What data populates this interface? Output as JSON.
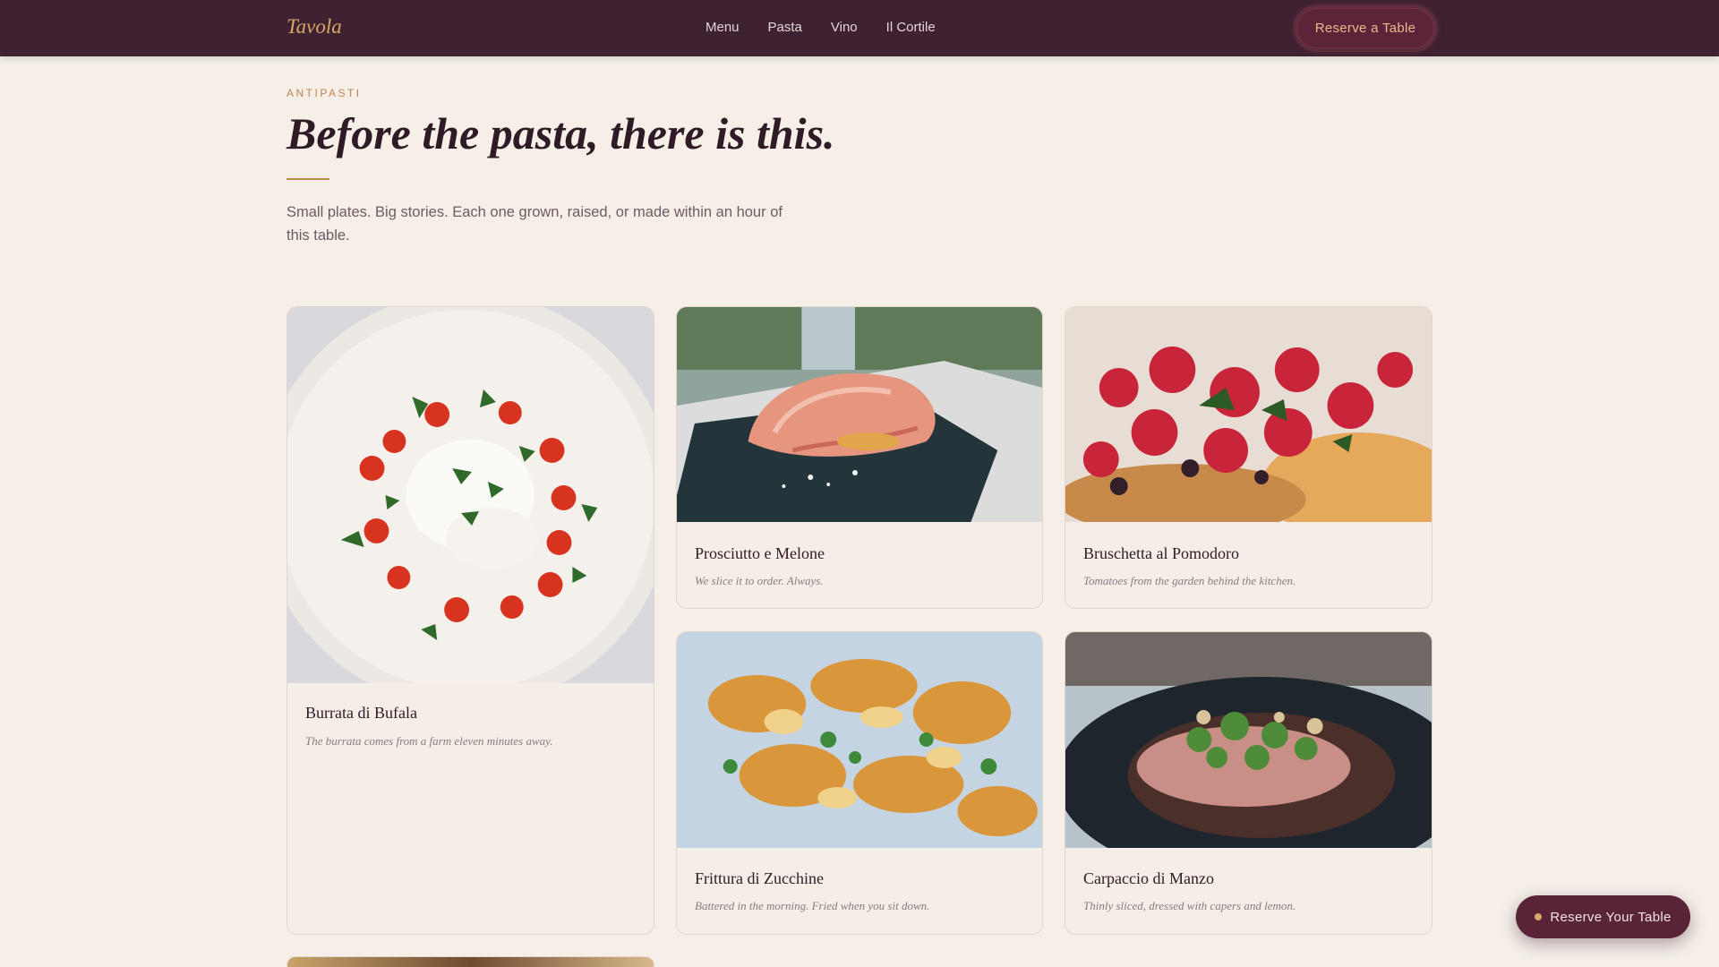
{
  "header": {
    "logo": "Tavola",
    "nav": [
      "Menu",
      "Pasta",
      "Vino",
      "Il Cortile"
    ],
    "cta": "Reserve a Table"
  },
  "intro": {
    "eyebrow": "ANTIPASTI",
    "title": "Before the pasta, there is this.",
    "lede": "Small plates. Big stories. Each one grown, raised, or made within an hour of this table."
  },
  "dishes": [
    {
      "name": "Burrata di Bufala",
      "desc": "The burrata comes from a farm eleven minutes away."
    },
    {
      "name": "Prosciutto e Melone",
      "desc": "We slice it to order. Always."
    },
    {
      "name": "Bruschetta al Pomodoro",
      "desc": "Tomatoes from the garden behind the kitchen."
    },
    {
      "name": "Frittura di Zucchine",
      "desc": "Battered in the morning. Fried when you sit down."
    },
    {
      "name": "Carpaccio di Manzo",
      "desc": "Thinly sliced, dressed with capers and lemon."
    }
  ],
  "floating_cta": "Reserve Your Table",
  "colors": {
    "header_bg": "#3e2231",
    "accent_gold": "#d9a767",
    "accent_copper": "#c0844f",
    "page_bg": "#f5efe8",
    "button_bg": "#5a2438"
  }
}
